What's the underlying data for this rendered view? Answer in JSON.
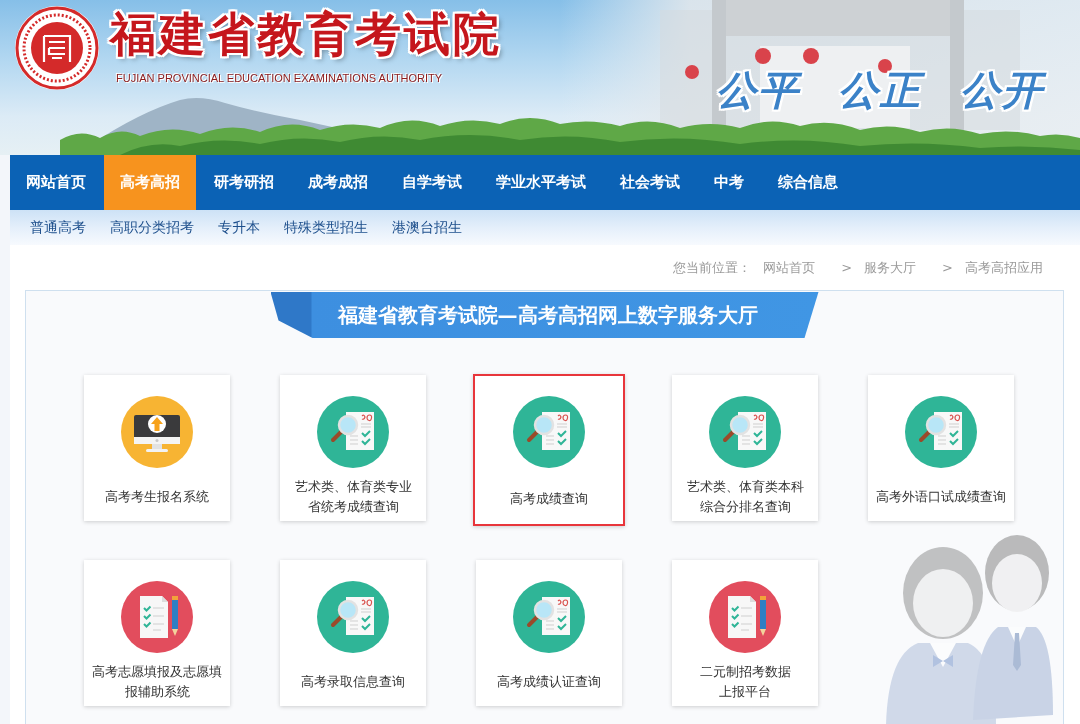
{
  "header": {
    "title": "福建省教育考试院",
    "subtitle": "FUJIAN PROVINCIAL EDUCATION EXAMINATIONS AUTHORITY",
    "slogan": [
      "公平",
      "公正",
      "公开"
    ]
  },
  "nav": [
    {
      "label": "网站首页",
      "selected": false
    },
    {
      "label": "高考高招",
      "selected": true
    },
    {
      "label": "研考研招",
      "selected": false
    },
    {
      "label": "成考成招",
      "selected": false
    },
    {
      "label": "自学考试",
      "selected": false
    },
    {
      "label": "学业水平考试",
      "selected": false
    },
    {
      "label": "社会考试",
      "selected": false
    },
    {
      "label": "中考",
      "selected": false
    },
    {
      "label": "综合信息",
      "selected": false
    }
  ],
  "subnav": [
    "普通高考",
    "高职分类招考",
    "专升本",
    "特殊类型招生",
    "港澳台招生"
  ],
  "breadcrumb": {
    "label": "您当前位置：",
    "items": [
      {
        "label": "网站首页"
      },
      {
        "separator": ">",
        "label": "服务大厅"
      },
      {
        "separator": ">",
        "label": "高考高招应用"
      }
    ]
  },
  "panel": {
    "title": "福建省教育考试院—高考高招网上数字服务大厅",
    "cards": [
      {
        "lines": [
          "高考考生报名系统"
        ],
        "kind": "monitor",
        "selected": false
      },
      {
        "lines": [
          "艺术类、体育类专业",
          "省统考成绩查询"
        ],
        "kind": "score",
        "selected": false
      },
      {
        "lines": [
          "高考成绩查询"
        ],
        "kind": "score",
        "selected": true
      },
      {
        "lines": [
          "艺术类、体育类本科",
          "综合分排名查询"
        ],
        "kind": "score",
        "selected": false
      },
      {
        "lines": [
          "高考外语口试成绩查询"
        ],
        "kind": "score",
        "selected": false
      },
      {
        "lines": [
          "高考志愿填报及志愿填",
          "报辅助系统"
        ],
        "kind": "form",
        "selected": false
      },
      {
        "lines": [
          "高考录取信息查询"
        ],
        "kind": "score",
        "selected": false
      },
      {
        "lines": [
          "高考成绩认证查询"
        ],
        "kind": "score",
        "selected": false
      },
      {
        "lines": [
          "二元制招考数据",
          "上报平台"
        ],
        "kind": "form",
        "selected": false
      }
    ]
  }
}
